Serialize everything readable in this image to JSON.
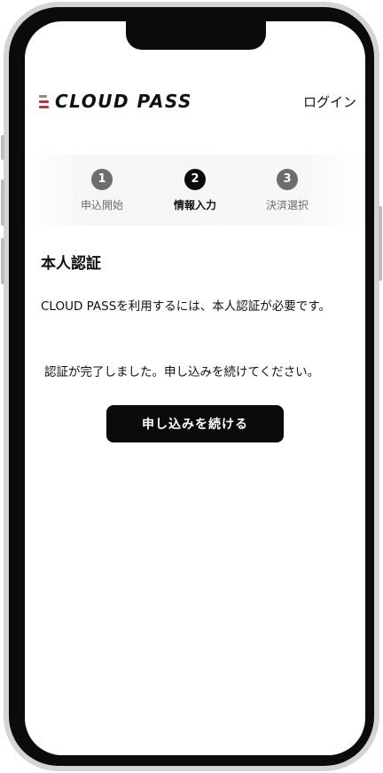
{
  "header": {
    "logo_text": "CLOUD PASS",
    "login_label": "ログイン"
  },
  "steps": [
    {
      "number": "1",
      "label": "申込開始",
      "state": "inactive"
    },
    {
      "number": "2",
      "label": "情報入力",
      "state": "active"
    },
    {
      "number": "3",
      "label": "決済選択",
      "state": "inactive"
    }
  ],
  "content": {
    "title": "本人認証",
    "description": "CLOUD PASSを利用するには、本人認証が必要です。",
    "status": "認証が完了しました。申し込みを続けてください。",
    "continue_label": "申し込みを続ける"
  },
  "colors": {
    "logo_red": "#e0243b",
    "logo_gray": "#8c8c8c",
    "button_bg": "#0b0b0b",
    "step_inactive": "#6d6c6e"
  }
}
